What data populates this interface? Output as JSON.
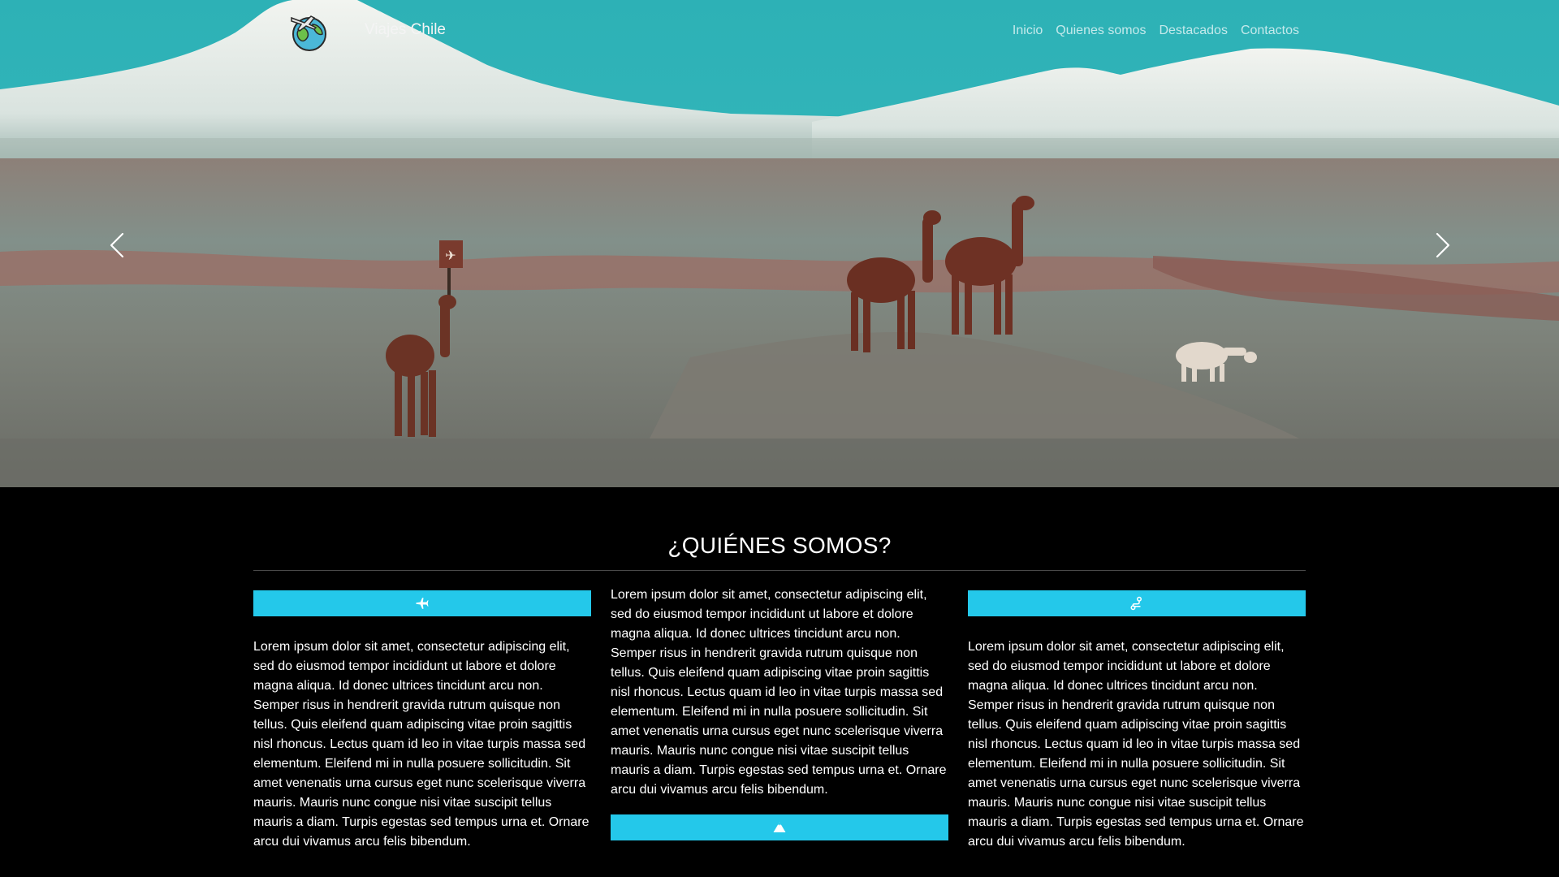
{
  "navbar": {
    "brand_name": "Viajes Chile",
    "logo_icon": "globe-plane-icon",
    "links": [
      {
        "label": "Inicio"
      },
      {
        "label": "Quienes somos"
      },
      {
        "label": "Destacados"
      },
      {
        "label": "Contactos"
      }
    ]
  },
  "carousel": {
    "prev_icon": "chevron-left-icon",
    "next_icon": "chevron-right-icon",
    "sign_glyph": "✈"
  },
  "about": {
    "title": "¿QUIÉNES SOMOS?",
    "accent_color": "#24c8ea",
    "columns": [
      {
        "icon": "airplane-icon",
        "text": "Lorem ipsum dolor sit amet, consectetur adipiscing elit, sed do eiusmod tempor incididunt ut labore et dolore magna aliqua. Id donec ultrices tincidunt arcu non. Semper risus in hendrerit gravida rutrum quisque non tellus. Quis eleifend quam adipiscing vitae proin sagittis nisl rhoncus. Lectus quam id leo in vitae turpis massa sed elementum. Eleifend mi in nulla posuere sollicitudin. Sit amet venenatis urna cursus eget nunc scelerisque viverra mauris. Mauris nunc congue nisi vitae suscipit tellus mauris a diam. Turpis egestas sed tempus urna et. Ornare arcu dui vivamus arcu felis bibendum."
      },
      {
        "icon": "mountain-icon",
        "text": "Lorem ipsum dolor sit amet, consectetur adipiscing elit, sed do eiusmod tempor incididunt ut labore et dolore magna aliqua. Id donec ultrices tincidunt arcu non. Semper risus in hendrerit gravida rutrum quisque non tellus. Quis eleifend quam adipiscing vitae proin sagittis nisl rhoncus. Lectus quam id leo in vitae turpis massa sed elementum. Eleifend mi in nulla posuere sollicitudin. Sit amet venenatis urna cursus eget nunc scelerisque viverra mauris. Mauris nunc congue nisi vitae suscipit tellus mauris a diam. Turpis egestas sed tempus urna et. Ornare arcu dui vivamus arcu felis bibendum."
      },
      {
        "icon": "route-icon",
        "text": "Lorem ipsum dolor sit amet, consectetur adipiscing elit, sed do eiusmod tempor incididunt ut labore et dolore magna aliqua. Id donec ultrices tincidunt arcu non. Semper risus in hendrerit gravida rutrum quisque non tellus. Quis eleifend quam adipiscing vitae proin sagittis nisl rhoncus. Lectus quam id leo in vitae turpis massa sed elementum. Eleifend mi in nulla posuere sollicitudin. Sit amet venenatis urna cursus eget nunc scelerisque viverra mauris. Mauris nunc congue nisi vitae suscipit tellus mauris a diam. Turpis egestas sed tempus urna et. Ornare arcu dui vivamus arcu felis bibendum."
      }
    ]
  }
}
